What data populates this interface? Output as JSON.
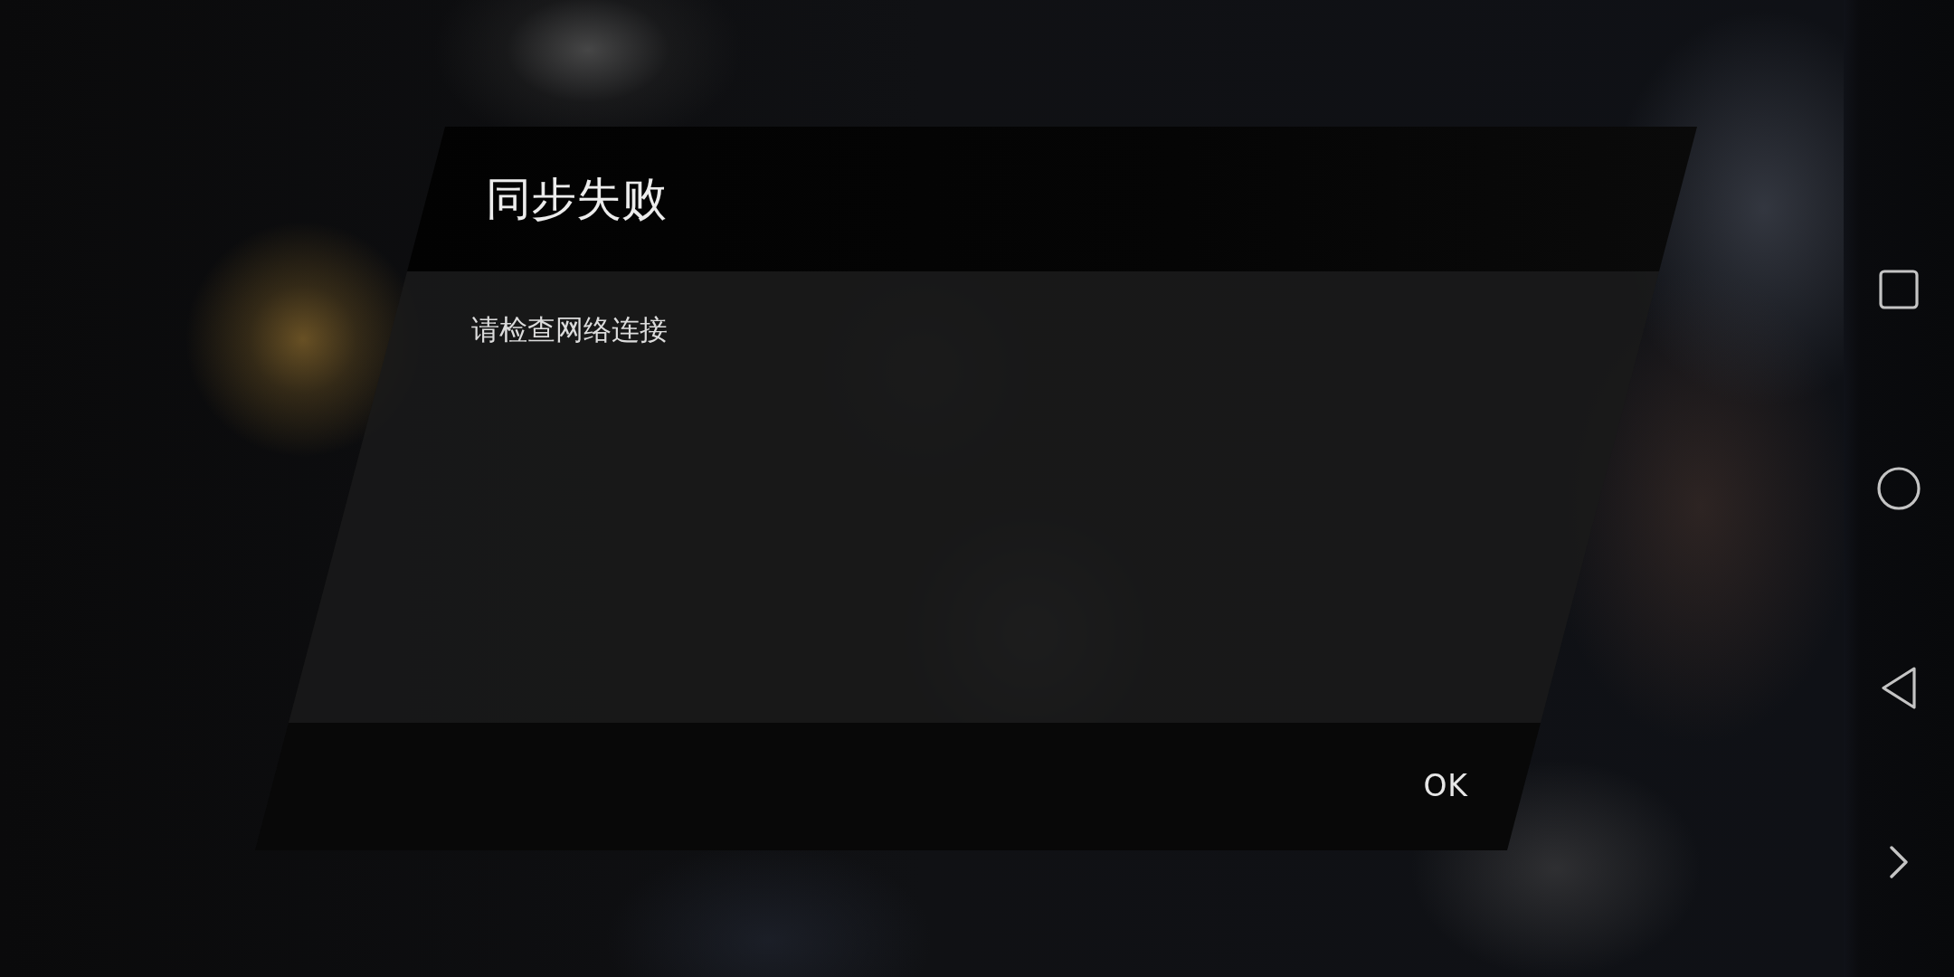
{
  "dialog": {
    "title": "同步失败",
    "message": "请检查网络连接",
    "buttons": [
      "OK"
    ]
  },
  "nav_bar": {
    "buttons": [
      {
        "kind": "square"
      },
      {
        "kind": "circle"
      },
      {
        "kind": "triangle"
      },
      {
        "kind": "chevron"
      }
    ]
  }
}
